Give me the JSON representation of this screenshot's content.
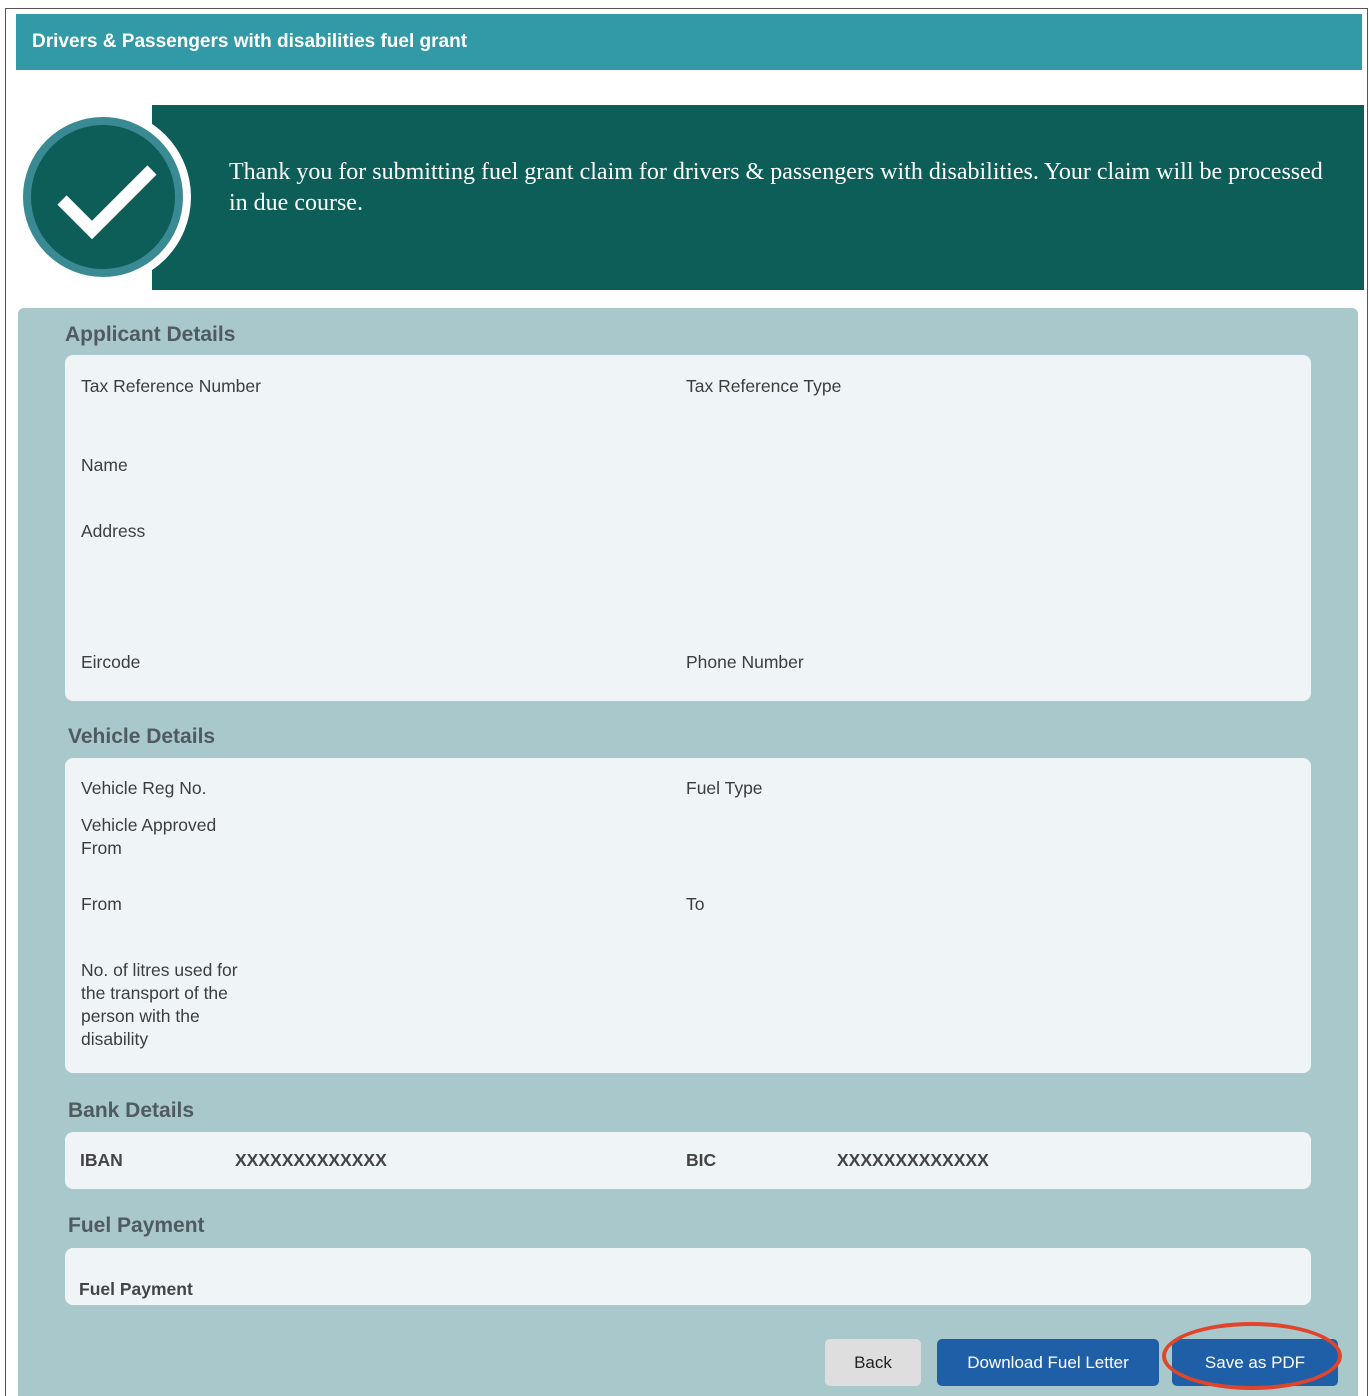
{
  "header": {
    "title": "Drivers & Passengers with disabilities fuel grant"
  },
  "banner": {
    "message": "Thank you for submitting fuel grant claim for drivers & passengers with disabilities.  Your claim will be processed in due course.",
    "icon": "checkmark-icon"
  },
  "applicant": {
    "title": "Applicant Details",
    "tax_ref_number": "Tax Reference Number",
    "tax_ref_type": "Tax Reference Type",
    "name": "Name",
    "address": "Address",
    "eircode": "Eircode",
    "phone": "Phone Number"
  },
  "vehicle": {
    "title": "Vehicle Details",
    "reg_no": "Vehicle Reg No.",
    "fuel_type": "Fuel Type",
    "approved_from": "Vehicle Approved From",
    "from": "From",
    "to": "To",
    "litres": "No. of litres used for the transport of the person with the disability"
  },
  "bank": {
    "title": "Bank Details",
    "iban_label": "IBAN",
    "iban_value": "XXXXXXXXXXXXX",
    "bic_label": "BIC",
    "bic_value": "XXXXXXXXXXXXX"
  },
  "fuel_payment": {
    "title": "Fuel Payment",
    "label": "Fuel Payment"
  },
  "buttons": {
    "back": "Back",
    "download": "Download Fuel Letter",
    "save_pdf": "Save as PDF"
  },
  "colors": {
    "header": "#3299a6",
    "banner": "#0d5e58",
    "panel": "#a8c8cc",
    "button_blue": "#1f5fa8",
    "highlight": "#e0442a"
  }
}
